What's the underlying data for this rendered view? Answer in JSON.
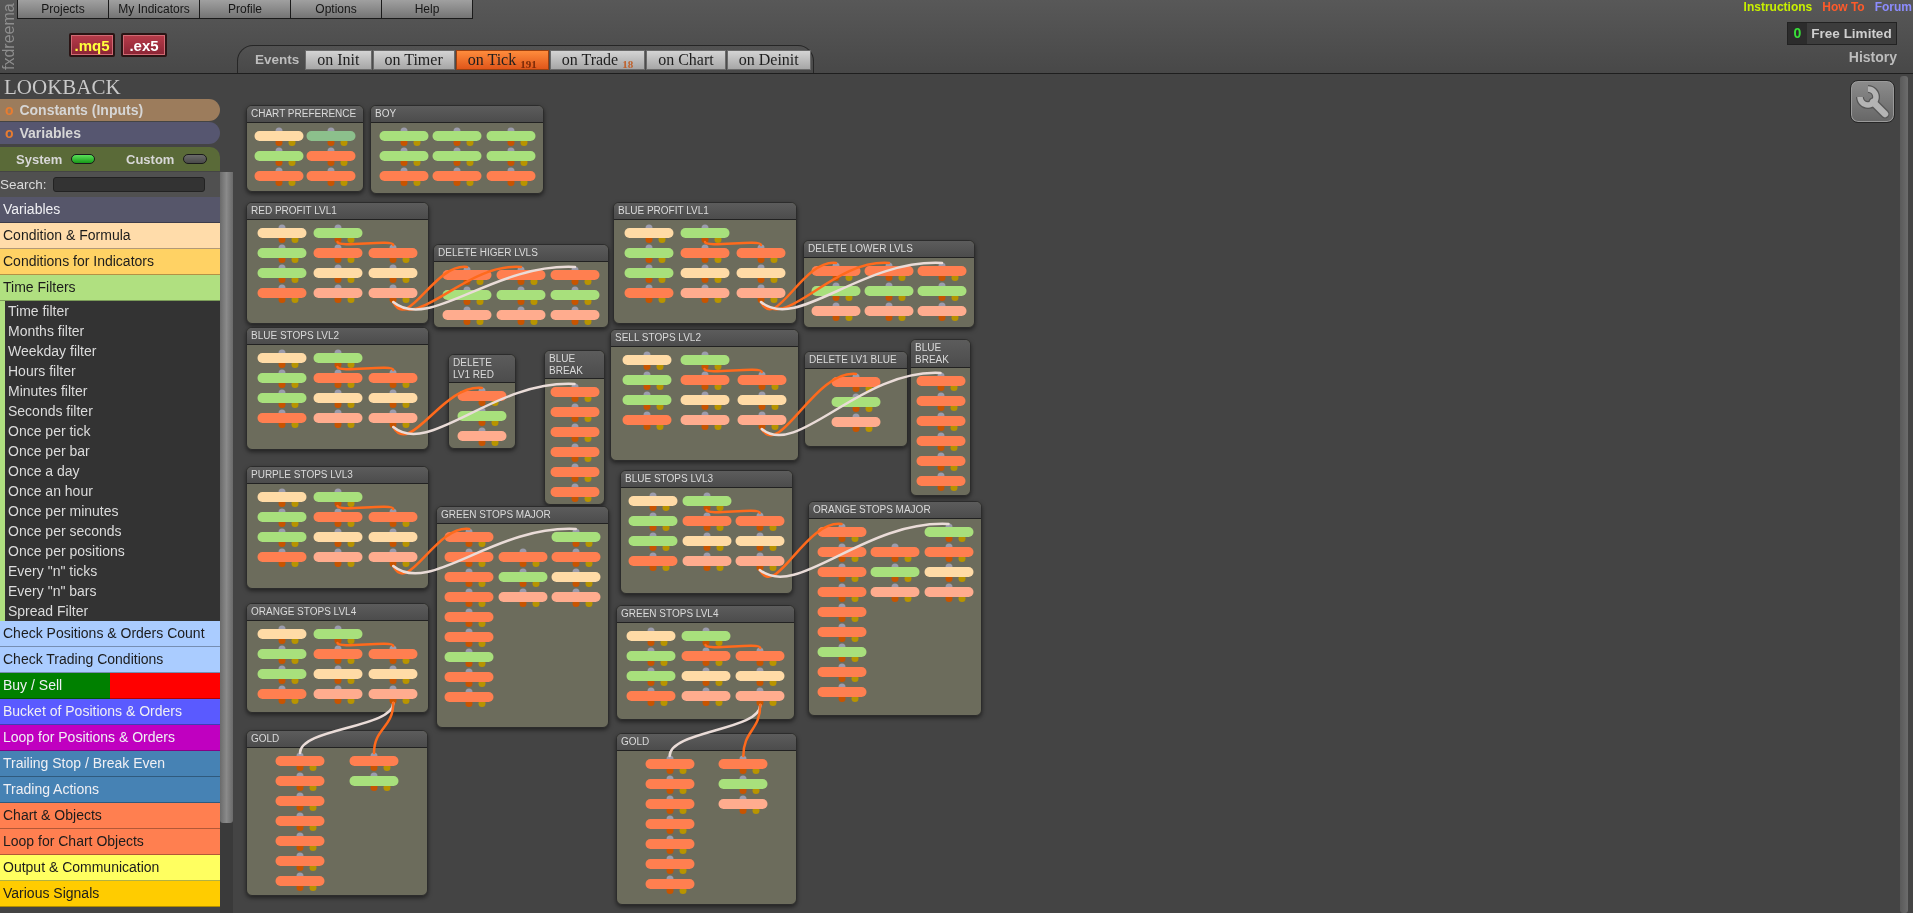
{
  "logo": "fxdreema",
  "menu": [
    "Projects",
    "My Indicators",
    "Profile",
    "Options",
    "Help"
  ],
  "export_buttons": [
    {
      "label": ".mq5",
      "kind": "source"
    },
    {
      "label": ".ex5",
      "kind": "compiled"
    }
  ],
  "links": [
    {
      "label": "Instructions",
      "color": "#c8f000"
    },
    {
      "label": "How To",
      "color": "#ff5a2a"
    },
    {
      "label": "Forum",
      "color": "#8c8cff"
    }
  ],
  "account": {
    "count": "0",
    "plan": "Free Limited"
  },
  "history": "History",
  "events": {
    "label": "Events",
    "tabs": [
      {
        "label": "on Init",
        "selected": false
      },
      {
        "label": "on Timer",
        "selected": false
      },
      {
        "label": "on Tick",
        "count": "191",
        "selected": true
      },
      {
        "label": "on Trade",
        "count": "18",
        "selected": false
      },
      {
        "label": "on Chart",
        "selected": false
      },
      {
        "label": "on Deinit",
        "selected": false
      }
    ]
  },
  "sidebar": {
    "title": "LOOKBACK",
    "sections": [
      {
        "bullet": "o",
        "label": "Constants (Inputs)",
        "color": "#9c7c5c"
      },
      {
        "bullet": "o",
        "label": "Variables",
        "color": "#565670"
      }
    ],
    "toggles": [
      {
        "label": "System",
        "on": true
      },
      {
        "label": "Custom",
        "on": false
      }
    ],
    "search": {
      "label": "Search:"
    },
    "categories": [
      {
        "label": "Variables",
        "color": "#56566a"
      },
      {
        "label": "Condition & Formula",
        "color": "#ffdcaa"
      },
      {
        "label": "Conditions for Indicators",
        "color": "#ffd264"
      },
      {
        "label": "Time Filters",
        "color": "#b0e080",
        "children": [
          {
            "label": "Time filter"
          },
          {
            "label": "Months filter"
          },
          {
            "label": "Weekday filter"
          },
          {
            "label": "Hours filter"
          },
          {
            "label": "Minutes filter"
          },
          {
            "label": "Seconds filter"
          },
          {
            "label": "Once per tick"
          },
          {
            "label": "Once per bar"
          },
          {
            "label": "Once a day"
          },
          {
            "label": "Once an hour"
          },
          {
            "label": "Once per minutes"
          },
          {
            "label": "Once per seconds"
          },
          {
            "label": "Once per positions"
          },
          {
            "label": "Every \"n\" ticks"
          },
          {
            "label": "Every \"n\" bars"
          },
          {
            "label": "Spread Filter"
          }
        ]
      },
      {
        "label": "Check Positions & Orders Count",
        "color": "#aaccff"
      },
      {
        "label": "Check Trading Conditions",
        "color": "#aaccff"
      },
      {
        "label": "Buy / Sell",
        "segments": [
          {
            "color": "#008000"
          },
          {
            "color": "#ff0000"
          }
        ]
      },
      {
        "label": "Bucket of Positions & Orders",
        "color": "#5a5aff"
      },
      {
        "label": "Loop for Positions & Orders",
        "color": "#c000c0"
      },
      {
        "label": "Trailing Stop / Break Even",
        "color": "#4682b4"
      },
      {
        "label": "Trading Actions",
        "color": "#4682b4"
      },
      {
        "label": "Chart & Objects",
        "color": "#ff7f50"
      },
      {
        "label": "Loop for Chart Objects",
        "color": "#ff7f50"
      },
      {
        "label": "Output & Communication",
        "color": "#ffff60"
      },
      {
        "label": "Various Signals",
        "color": "#ffcc00"
      }
    ]
  },
  "canvas": {
    "groups": [
      {
        "title": "CHART PREFERENCE",
        "columns": [
          [
            {
              "color": "#ffdba6"
            },
            {
              "color": "#a8e07c"
            },
            {
              "color": "#ff7f50"
            }
          ],
          [
            {
              "color": "#8cc08c"
            },
            {
              "color": "#ff7f50"
            },
            {
              "color": "#ff7f50"
            }
          ]
        ]
      },
      {
        "title": "BOY",
        "columns": [
          [
            {
              "color": "#a8e07c"
            },
            {
              "color": "#a8e07c"
            },
            {
              "color": "#ff7f50"
            }
          ],
          [
            {
              "color": "#a8e07c"
            },
            {
              "color": "#a8e07c"
            },
            {
              "color": "#ff7f50"
            }
          ],
          [
            {
              "color": "#a8e07c"
            },
            {
              "color": "#a8e07c"
            },
            {
              "color": "#ff7f50"
            }
          ]
        ]
      },
      {
        "title": "RED PROFIT LVL1",
        "columns": [
          [
            {
              "color": "#ffdba6"
            },
            {
              "color": "#a8e07c"
            },
            {
              "color": "#a8e07c"
            },
            {
              "color": "#ff7f50"
            }
          ],
          [
            {
              "color": "#a8e07c"
            },
            {
              "color": "#ff7f50"
            },
            {
              "color": "#ffdba6"
            },
            {
              "color": "#ffac8e"
            }
          ],
          [
            {
              "color": "#ff7f50"
            },
            {
              "color": "#ffdba6"
            },
            {
              "color": "#ffac8e"
            }
          ]
        ]
      },
      {
        "title": "DELETE HIGER LVLS",
        "columns": [
          [
            {
              "color": "#ff7f50"
            },
            {
              "color": "#a8e07c"
            },
            {
              "color": "#ffac8e"
            }
          ],
          [
            {
              "color": "#ff7f50"
            },
            {
              "color": "#a8e07c"
            },
            {
              "color": "#ffac8e"
            }
          ],
          [
            {
              "color": "#ff7f50"
            },
            {
              "color": "#a8e07c"
            },
            {
              "color": "#ffac8e"
            }
          ]
        ]
      },
      {
        "title": "BLUE PROFIT LVL1",
        "columns": [
          [
            {
              "color": "#ffdba6"
            },
            {
              "color": "#a8e07c"
            },
            {
              "color": "#a8e07c"
            },
            {
              "color": "#ff7f50"
            }
          ],
          [
            {
              "color": "#a8e07c"
            },
            {
              "color": "#ff7f50"
            },
            {
              "color": "#ffdba6"
            },
            {
              "color": "#ffac8e"
            }
          ],
          [
            {
              "color": "#ff7f50"
            },
            {
              "color": "#ffdba6"
            },
            {
              "color": "#ffac8e"
            }
          ]
        ]
      },
      {
        "title": "DELETE LOWER LVLS",
        "columns": [
          [
            {
              "color": "#ff7f50"
            },
            {
              "color": "#a8e07c"
            },
            {
              "color": "#ffac8e"
            }
          ],
          [
            {
              "color": "#ff7f50"
            },
            {
              "color": "#a8e07c"
            },
            {
              "color": "#ffac8e"
            }
          ],
          [
            {
              "color": "#ff7f50"
            },
            {
              "color": "#a8e07c"
            },
            {
              "color": "#ffac8e"
            }
          ]
        ]
      },
      {
        "title": "BLUE STOPS LVL2",
        "columns": [
          [
            {
              "color": "#ffdba6"
            },
            {
              "color": "#a8e07c"
            },
            {
              "color": "#a8e07c"
            },
            {
              "color": "#ff7f50"
            }
          ],
          [
            {
              "color": "#a8e07c"
            },
            {
              "color": "#ff7f50"
            },
            {
              "color": "#ffdba6"
            },
            {
              "color": "#ffac8e"
            }
          ],
          [
            {
              "color": "#ff7f50"
            },
            {
              "color": "#ffdba6"
            },
            {
              "color": "#ffac8e"
            }
          ]
        ]
      },
      {
        "title": "DELETE LV1 RED",
        "columns": [
          [
            {
              "color": "#ff7f50"
            },
            {
              "color": "#a8e07c"
            },
            {
              "color": "#ffac8e"
            }
          ]
        ]
      },
      {
        "title": "BLUE BREAK",
        "columns": [
          [
            {
              "color": "#ff7f50"
            },
            {
              "color": "#ff7f50"
            },
            {
              "color": "#ff7f50"
            },
            {
              "color": "#ff7f50"
            },
            {
              "color": "#ff7f50"
            },
            {
              "color": "#ff7f50"
            }
          ]
        ]
      },
      {
        "title": "SELL STOPS LVL2",
        "columns": [
          [
            {
              "color": "#ffdba6"
            },
            {
              "color": "#a8e07c"
            },
            {
              "color": "#a8e07c"
            },
            {
              "color": "#ff7f50"
            }
          ],
          [
            {
              "color": "#a8e07c"
            },
            {
              "color": "#ff7f50"
            },
            {
              "color": "#ffdba6"
            },
            {
              "color": "#ffac8e"
            }
          ],
          [
            {
              "color": "#ff7f50"
            },
            {
              "color": "#ffdba6"
            },
            {
              "color": "#ffac8e"
            }
          ]
        ]
      },
      {
        "title": "DELETE LV1 BLUE",
        "columns": [
          [
            {
              "color": "#ff7f50"
            },
            {
              "color": "#a8e07c"
            },
            {
              "color": "#ffac8e"
            }
          ]
        ]
      },
      {
        "title": "BLUE BREAK",
        "columns": [
          [
            {
              "color": "#ff7f50"
            },
            {
              "color": "#ff7f50"
            },
            {
              "color": "#ff7f50"
            },
            {
              "color": "#ff7f50"
            },
            {
              "color": "#ff7f50"
            },
            {
              "color": "#ff7f50"
            }
          ]
        ]
      },
      {
        "title": "PURPLE STOPS LVL3",
        "columns": [
          [
            {
              "color": "#ffdba6"
            },
            {
              "color": "#a8e07c"
            },
            {
              "color": "#a8e07c"
            },
            {
              "color": "#ff7f50"
            }
          ],
          [
            {
              "color": "#a8e07c"
            },
            {
              "color": "#ff7f50"
            },
            {
              "color": "#ffdba6"
            },
            {
              "color": "#ffac8e"
            }
          ],
          [
            {
              "color": "#ff7f50"
            },
            {
              "color": "#ffdba6"
            },
            {
              "color": "#ffac8e"
            }
          ]
        ]
      },
      {
        "title": "GREEN STOPS MAJOR",
        "columns": [
          [
            {
              "color": "#ff7f50"
            },
            {
              "color": "#ff7f50"
            },
            {
              "color": "#ff7f50"
            },
            {
              "color": "#ff7f50"
            },
            {
              "color": "#ff7f50"
            },
            {
              "color": "#ff7f50"
            },
            {
              "color": "#a8e07c"
            },
            {
              "color": "#ff7f50"
            },
            {
              "color": "#ff7f50"
            }
          ],
          [
            {
              "color": "#ff7f50"
            },
            {
              "color": "#a8e07c"
            },
            {
              "color": "#ffac8e"
            }
          ],
          [
            {
              "color": "#a8e07c"
            },
            {
              "color": "#ff7f50"
            },
            {
              "color": "#ffdba6"
            },
            {
              "color": "#ffac8e"
            }
          ]
        ]
      },
      {
        "title": "BLUE STOPS LVL3",
        "columns": [
          [
            {
              "color": "#ffdba6"
            },
            {
              "color": "#a8e07c"
            },
            {
              "color": "#a8e07c"
            },
            {
              "color": "#ff7f50"
            }
          ],
          [
            {
              "color": "#a8e07c"
            },
            {
              "color": "#ff7f50"
            },
            {
              "color": "#ffdba6"
            },
            {
              "color": "#ffac8e"
            }
          ],
          [
            {
              "color": "#ff7f50"
            },
            {
              "color": "#ffdba6"
            },
            {
              "color": "#ffac8e"
            }
          ]
        ]
      },
      {
        "title": "ORANGE STOPS MAJOR",
        "columns": [
          [
            {
              "color": "#ff7f50"
            },
            {
              "color": "#ff7f50"
            },
            {
              "color": "#ff7f50"
            },
            {
              "color": "#ff7f50"
            },
            {
              "color": "#ff7f50"
            },
            {
              "color": "#ff7f50"
            },
            {
              "color": "#a8e07c"
            },
            {
              "color": "#ff7f50"
            },
            {
              "color": "#ff7f50"
            }
          ],
          [
            {
              "color": "#ff7f50"
            },
            {
              "color": "#a8e07c"
            },
            {
              "color": "#ffac8e"
            }
          ],
          [
            {
              "color": "#a8e07c"
            },
            {
              "color": "#ff7f50"
            },
            {
              "color": "#ffdba6"
            },
            {
              "color": "#ffac8e"
            }
          ]
        ]
      },
      {
        "title": "ORANGE STOPS LVL4",
        "columns": [
          [
            {
              "color": "#ffdba6"
            },
            {
              "color": "#a8e07c"
            },
            {
              "color": "#a8e07c"
            },
            {
              "color": "#ff7f50"
            }
          ],
          [
            {
              "color": "#a8e07c"
            },
            {
              "color": "#ff7f50"
            },
            {
              "color": "#ffdba6"
            },
            {
              "color": "#ffac8e"
            }
          ],
          [
            {
              "color": "#ff7f50"
            },
            {
              "color": "#ffdba6"
            },
            {
              "color": "#ffac8e"
            }
          ]
        ]
      },
      {
        "title": "GREEN STOPS LVL4",
        "columns": [
          [
            {
              "color": "#ffdba6"
            },
            {
              "color": "#a8e07c"
            },
            {
              "color": "#a8e07c"
            },
            {
              "color": "#ff7f50"
            }
          ],
          [
            {
              "color": "#a8e07c"
            },
            {
              "color": "#ff7f50"
            },
            {
              "color": "#ffdba6"
            },
            {
              "color": "#ffac8e"
            }
          ],
          [
            {
              "color": "#ff7f50"
            },
            {
              "color": "#ffdba6"
            },
            {
              "color": "#ffac8e"
            }
          ]
        ]
      },
      {
        "title": "GOLD",
        "columns": [
          [
            {
              "color": "#ff7f50"
            },
            {
              "color": "#ff7f50"
            },
            {
              "color": "#ff7f50"
            },
            {
              "color": "#ff7f50"
            },
            {
              "color": "#ff7f50"
            },
            {
              "color": "#ff7f50"
            },
            {
              "color": "#ff7f50"
            }
          ],
          [
            {
              "color": "#ff7f50"
            },
            {
              "color": "#a8e07c"
            }
          ]
        ]
      },
      {
        "title": "GOLD",
        "columns": [
          [
            {
              "color": "#ff7f50"
            },
            {
              "color": "#ff7f50"
            },
            {
              "color": "#ff7f50"
            },
            {
              "color": "#ff7f50"
            },
            {
              "color": "#ff7f50"
            },
            {
              "color": "#ff7f50"
            },
            {
              "color": "#ff7f50"
            }
          ],
          [
            {
              "color": "#ff7f50"
            },
            {
              "color": "#a8e07c"
            },
            {
              "color": "#ffac8e"
            }
          ]
        ]
      }
    ]
  }
}
